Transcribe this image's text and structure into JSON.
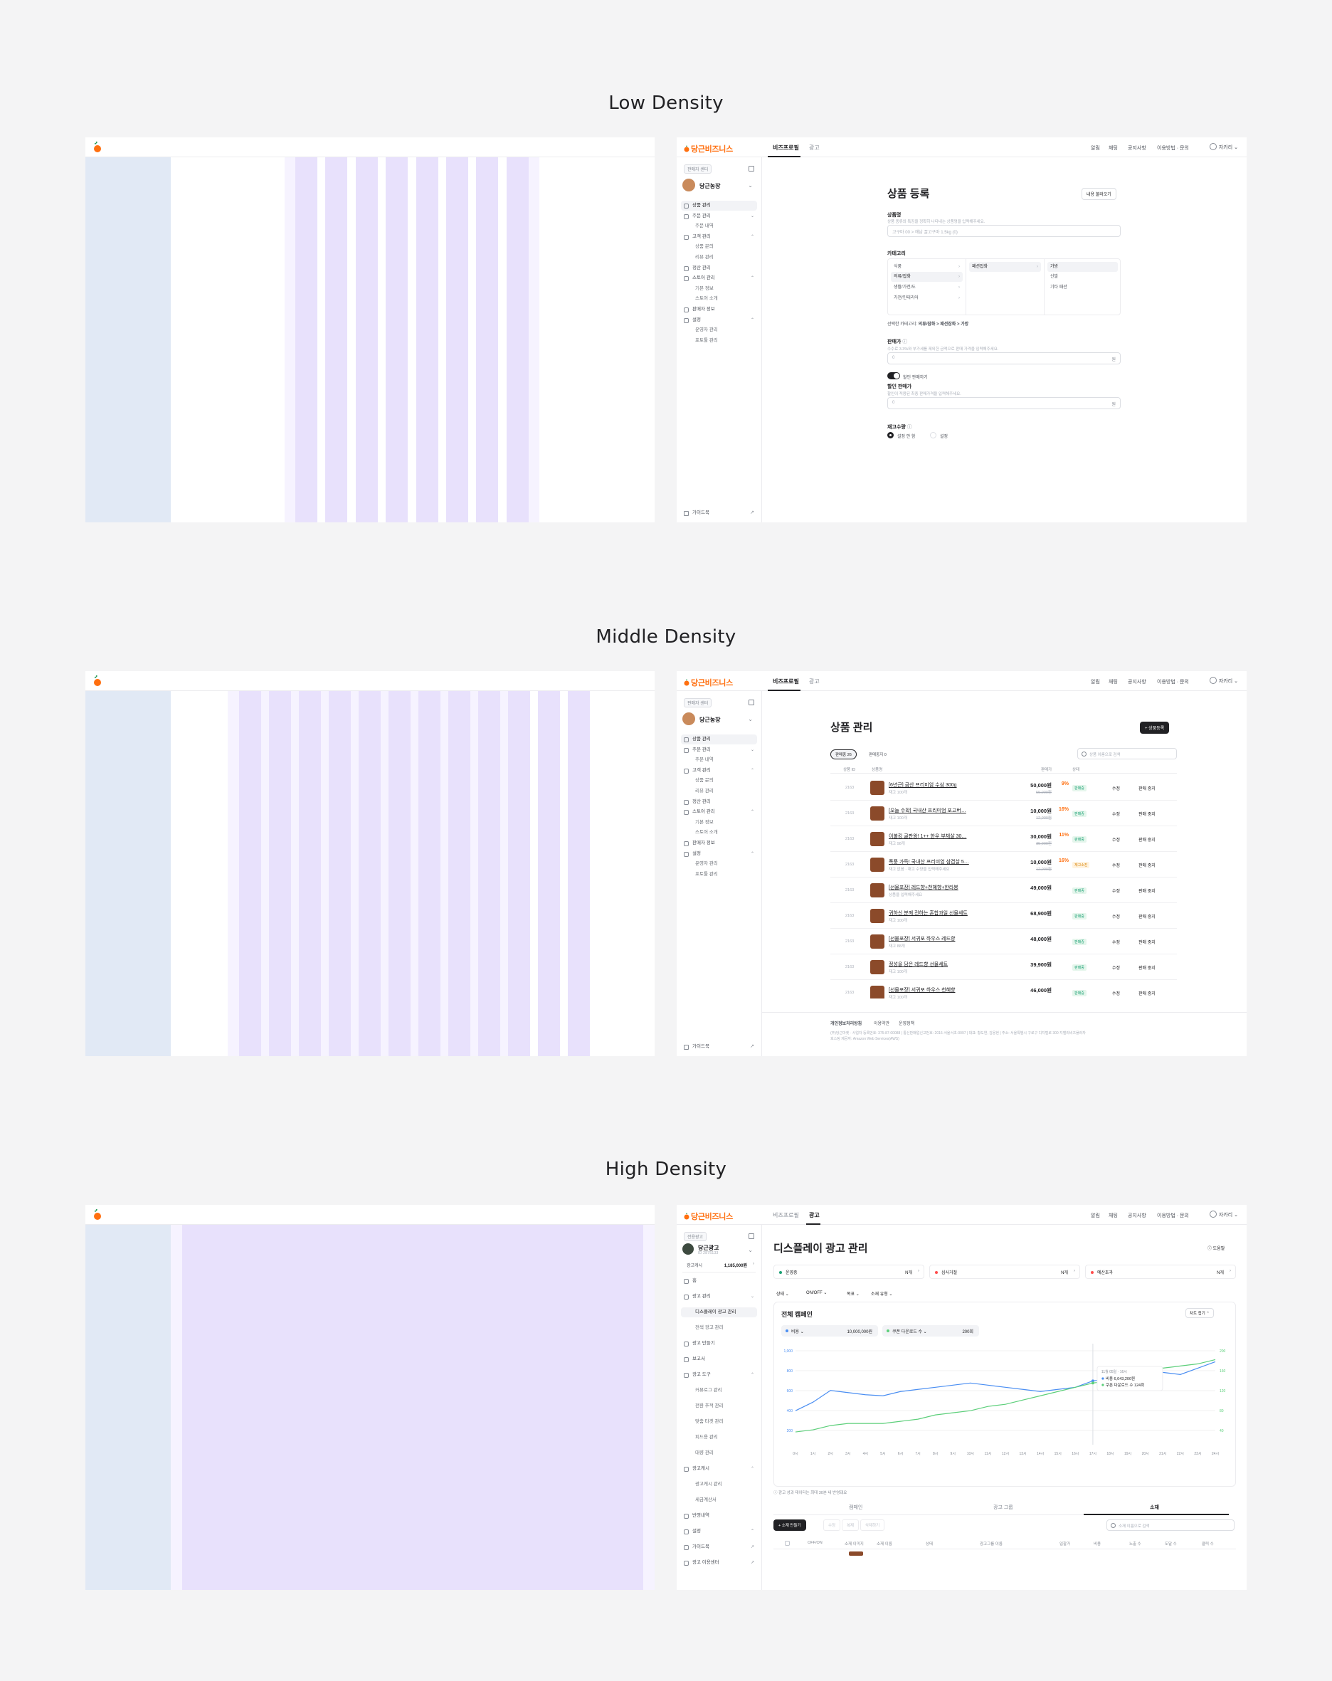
{
  "sections": {
    "low": {
      "title": "Low Density"
    },
    "middle": {
      "title": "Middle Density"
    },
    "high": {
      "title": "High Density"
    }
  },
  "app": {
    "brand": "당근비즈니스",
    "tabs": [
      "비즈프로필",
      "광고"
    ],
    "top_links": [
      "알림",
      "채팅",
      "공지사항",
      "이용방법 · 문의"
    ],
    "user": "자카리"
  },
  "sidebar_seller": {
    "badge": "판매자 센터",
    "store_name": "당근농장",
    "items": [
      {
        "label": "상품 관리",
        "level": 0,
        "selected": true
      },
      {
        "label": "주문 관리",
        "level": 0,
        "caret": "⌄"
      },
      {
        "label": "주문 내역",
        "level": 1
      },
      {
        "label": "고객 관리",
        "level": 0,
        "caret": "⌃"
      },
      {
        "label": "상품 문의",
        "level": 1
      },
      {
        "label": "리뷰 관리",
        "level": 1
      },
      {
        "label": "정산 관리",
        "level": 0
      },
      {
        "label": "스토어 관리",
        "level": 0,
        "caret": "⌃"
      },
      {
        "label": "기본 정보",
        "level": 1
      },
      {
        "label": "스토어 소개",
        "level": 1
      },
      {
        "label": "판매자 정보",
        "level": 0
      },
      {
        "label": "설정",
        "level": 0,
        "caret": "⌃"
      },
      {
        "label": "운영자 관리",
        "level": 1
      },
      {
        "label": "포토툴 관리",
        "level": 1
      }
    ],
    "footer": "가이드북"
  },
  "low_form": {
    "title": "상품 등록",
    "load_button": "내용 불러오기",
    "name_label": "상품명",
    "name_hint": "상품 종류와 특징을 정확히 나타내는 상품명을 입력해주세요.",
    "name_placeholder": "고구마 00 > 해남 꿀고구마 1.5kg (0)",
    "category_label": "카테고리",
    "cat_col1": [
      "식품",
      "의류/잡화",
      "생활/가전/도",
      "가전/인테리어"
    ],
    "cat_col2": [
      "패션잡화"
    ],
    "cat_col3": [
      "가방",
      "신발",
      "기타 패션"
    ],
    "cat_selected_prefix": "선택한 카테고리:",
    "cat_selected": "의류/잡화 > 패션잡화 > 가방",
    "price_label": "판매가",
    "price_hint": "수수료 3.3%와 부가세를 제외한 금액으로 판매 가격을 입력해주세요.",
    "price_placeholder": "0",
    "unit": "원",
    "toggle_label": "할인 판매하기",
    "discount_label": "할인 판매가",
    "discount_hint": "할인이 적용된 최종 판매가격을 입력해주세요.",
    "stock_label": "재고수량",
    "stock_opt1": "설정 안 함",
    "stock_opt2": "설정"
  },
  "mid_table": {
    "title": "상품 관리",
    "add_button": "+ 상품등록",
    "tab_on": "판매중 26",
    "tab_off": "판매중지 0",
    "search_placeholder": "상품 이름으로 검색",
    "headers": [
      "상품 ID",
      "상품명",
      "판매가",
      "상태"
    ],
    "rows": [
      {
        "id": "2163",
        "name": "[6년근] 금산 프리미엄 수삼 300g",
        "stock": "재고 100개",
        "disc": "9%",
        "price": "50,000원",
        "orig": "55,000원",
        "status": "판매중",
        "warn": false
      },
      {
        "id": "2163",
        "name": "[오늘 수확] 국내산 프리미엄 포고버…",
        "stock": "재고 100개",
        "disc": "16%",
        "price": "10,000원",
        "orig": "12,000원",
        "status": "판매중",
        "warn": false
      },
      {
        "id": "2163",
        "name": "이불킹 골판왕! 1++ 한우 부채살 30…",
        "stock": "재고 98개",
        "disc": "11%",
        "price": "30,000원",
        "orig": "35,000원",
        "status": "판매중",
        "warn": false
      },
      {
        "id": "2163",
        "name": "폭풍 가득! 국내산 프리미엄 삼겹살 5…",
        "stock": "재고 없음 · 재고 수량을 입력해주세요",
        "disc": "16%",
        "price": "10,000원",
        "orig": "12,000원",
        "status": "재고소진",
        "warn": true
      },
      {
        "id": "2163",
        "name": "[선물포장] 레드향+천혜향+한라봉",
        "stock": "상품을 입력해주세요",
        "disc": "",
        "price": "49,000원",
        "orig": "",
        "status": "판매중",
        "warn": false
      },
      {
        "id": "2163",
        "name": "귀하신 분께 전하는 혼합과일 선물세트",
        "stock": "재고 100개",
        "disc": "",
        "price": "68,900원",
        "orig": "",
        "status": "판매중",
        "warn": false
      },
      {
        "id": "2163",
        "name": "[선물포장] 서귀포 하우스 레드향",
        "stock": "재고 88개",
        "disc": "",
        "price": "48,000원",
        "orig": "",
        "status": "판매중",
        "warn": false
      },
      {
        "id": "2163",
        "name": "정성을 담은 레드향 선물세트",
        "stock": "재고 100개",
        "disc": "",
        "price": "39,900원",
        "orig": "",
        "status": "판매중",
        "warn": false
      },
      {
        "id": "2163",
        "name": "[선물포장] 서귀포 하우스 천혜향",
        "stock": "재고 100개",
        "disc": "",
        "price": "46,000원",
        "orig": "",
        "status": "판매중",
        "warn": false
      }
    ],
    "edit": "수정",
    "stop": "판매 중지",
    "footer_links": [
      "개인정보처리방침",
      "이용약관",
      "운영정책"
    ],
    "footer_text": "(주)당근마켓 · 사업자 등록번호: 375-87-00088 | 통신판매업신고번호: 2016-서울서초-0097 | 대표: 황도연, 김용현 | 주소: 서울특별시 구로구 디지털로 300 지밸리비즈플라자",
    "footer_text2": "호스팅 제공자: Amazon Web Services(AWS)"
  },
  "sidebar_ads": {
    "badge": "전용광고",
    "store_name": "당근광고",
    "store_id": "ID 2875133",
    "money_label": "광고캐시",
    "money": "1,185,000원",
    "items": [
      {
        "label": "홈",
        "level": 0
      },
      {
        "label": "광고 관리",
        "level": 0,
        "caret": "⌄"
      },
      {
        "label": "디스플레이 광고 관리",
        "level": 1,
        "selected": true
      },
      {
        "label": "전색 광고 관리",
        "level": 1
      },
      {
        "label": "광고 만들기",
        "level": 0
      },
      {
        "label": "보고서",
        "level": 0
      },
      {
        "label": "광고 도구",
        "level": 0,
        "caret": "⌃"
      },
      {
        "label": "커뮤로그 관리",
        "level": 1
      },
      {
        "label": "전환 추적 관리",
        "level": 1
      },
      {
        "label": "맞춤 타겟 관리",
        "level": 1
      },
      {
        "label": "피드용 관리",
        "level": 1
      },
      {
        "label": "대량 관리",
        "level": 1
      },
      {
        "label": "광고캐시",
        "level": 0,
        "caret": "⌃"
      },
      {
        "label": "광고캐시 관리",
        "level": 1
      },
      {
        "label": "세금계산서",
        "level": 1
      },
      {
        "label": "반영내역",
        "level": 0
      },
      {
        "label": "설정",
        "level": 0,
        "caret": "⌃"
      },
      {
        "label": "가이드북",
        "level": 0,
        "caret": "↗"
      },
      {
        "label": "광고 이용센터",
        "level": 0,
        "caret": "↗"
      }
    ]
  },
  "high_ads": {
    "title": "디스플레이 광고 관리",
    "guide": "ⓘ 도움말",
    "kpis": [
      {
        "label": "운영중",
        "value": "N개",
        "color": "#1aa174"
      },
      {
        "label": "심사거절",
        "value": "N개",
        "color": "#ff4d4d"
      },
      {
        "label": "예산초과",
        "value": "N개",
        "color": "#ff4d4d"
      }
    ],
    "filters": [
      "상태 ⌄",
      "ON/OFF ⌄",
      "목표 ⌄",
      "소재 유형 ⌄"
    ],
    "chart_title": "전체 캠페인",
    "chart_toggle": "차트 접기 ⌃",
    "metric1_label": "비용 ⌄",
    "metric1_value": "10,000,000원",
    "metric2_label": "쿠폰 다운로드 수 ⌄",
    "metric2_value": "200회",
    "tooltip_title": "11월 05일 · 16시",
    "tooltip_l1": "비용 6,043,200원",
    "tooltip_l2": "쿠폰 다운로드 수 124회",
    "note": "광고 성과 데이터는 최대 30분 내 반영돼요",
    "sub_tabs": [
      "캠페인",
      "광고 그룹",
      "소재"
    ],
    "actions": [
      "+ 소재 만들기",
      "수정",
      "복제",
      "삭제하기"
    ],
    "search_placeholder": "소재 이름으로 검색",
    "col_headers": [
      "OFF/ON",
      "소재 이미지",
      "소재 이름",
      "상태",
      "광고그룹 이름",
      "입찰가",
      "비용",
      "노출 수",
      "도달 수",
      "클릭 수"
    ]
  },
  "chart_data": {
    "type": "line",
    "title": "전체 캠페인",
    "x": [
      "0시",
      "1시",
      "2시",
      "3시",
      "4시",
      "5시",
      "6시",
      "7시",
      "8시",
      "9시",
      "10시",
      "11시",
      "12시",
      "13시",
      "14시",
      "15시",
      "16시",
      "17시",
      "18시",
      "19시",
      "20시",
      "21시",
      "22시",
      "23시",
      "24시"
    ],
    "y_left_ticks": [
      "1,000",
      "800",
      "600",
      "400",
      "200"
    ],
    "y_right_ticks": [
      "200",
      "160",
      "120",
      "80",
      "40"
    ],
    "series": [
      {
        "name": "비용",
        "color": "#4a8ef2",
        "values": [
          420,
          500,
          610,
          590,
          570,
          560,
          600,
          620,
          640,
          660,
          680,
          660,
          640,
          620,
          600,
          620,
          640,
          700,
          720,
          800,
          820,
          780,
          760,
          820,
          880
        ]
      },
      {
        "name": "쿠폰 다운로드 수",
        "color": "#5ccf7a",
        "values": [
          220,
          240,
          280,
          300,
          300,
          300,
          320,
          340,
          380,
          400,
          420,
          460,
          480,
          520,
          560,
          600,
          640,
          680,
          700,
          760,
          800,
          820,
          840,
          860,
          900
        ]
      }
    ]
  }
}
